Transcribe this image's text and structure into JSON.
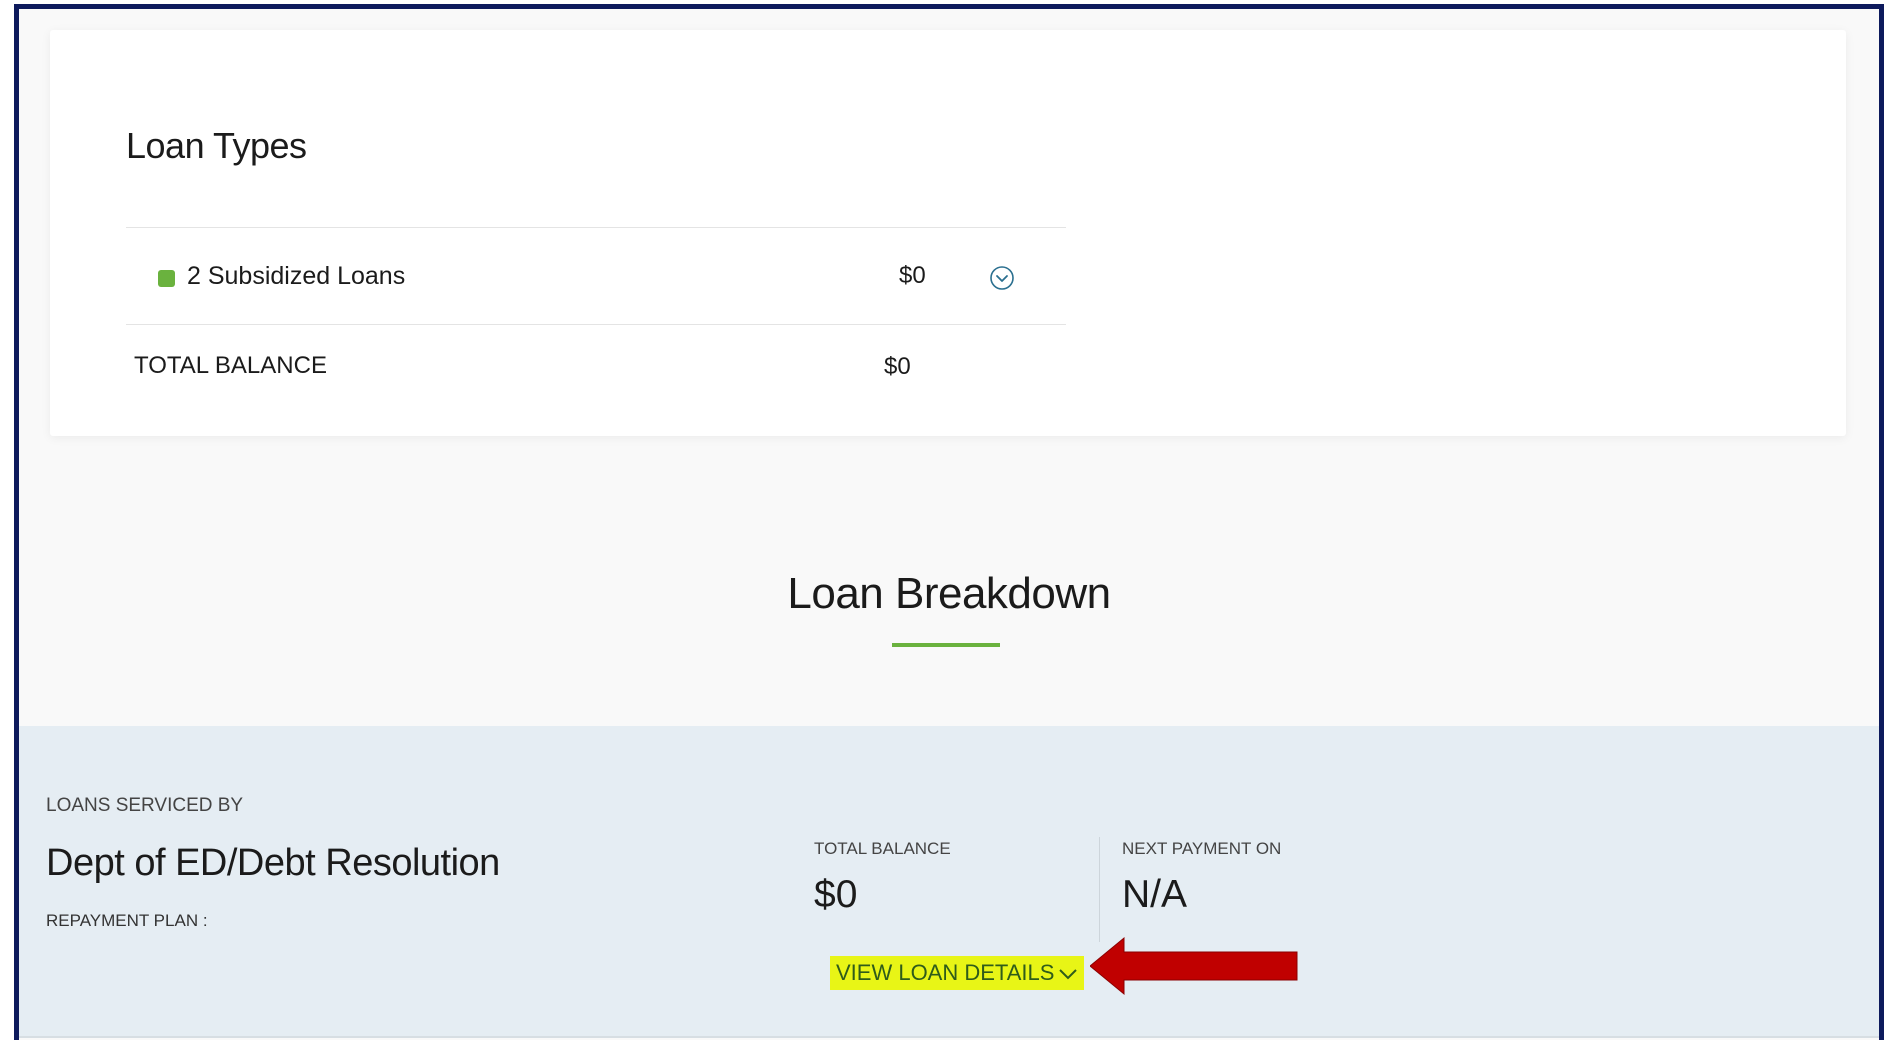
{
  "loan_types": {
    "title": "Loan Types",
    "items": [
      {
        "label": "2 Subsidized Loans",
        "amount": "$0",
        "color": "#6ab23e",
        "expand_icon": "chevron-down-circle-icon"
      }
    ],
    "total_label": "TOTAL BALANCE",
    "total_amount": "$0"
  },
  "loan_breakdown": {
    "title": "Loan Breakdown",
    "accent_color": "#6ab23e"
  },
  "servicer": {
    "serviced_by_label": "LOANS SERVICED BY",
    "name": "Dept of ED/Debt Resolution",
    "repayment_plan_label": "REPAYMENT PLAN :",
    "total_balance_label": "TOTAL BALANCE",
    "total_balance_value": "$0",
    "next_payment_label": "NEXT PAYMENT ON",
    "next_payment_value": "N/A",
    "view_details_label": "VIEW LOAN DETAILS",
    "view_details_icon": "chevron-down-icon",
    "highlight_color": "#e8f516"
  },
  "annotation": {
    "arrow_color": "#c00000",
    "arrow_icon": "left-arrow-icon"
  }
}
